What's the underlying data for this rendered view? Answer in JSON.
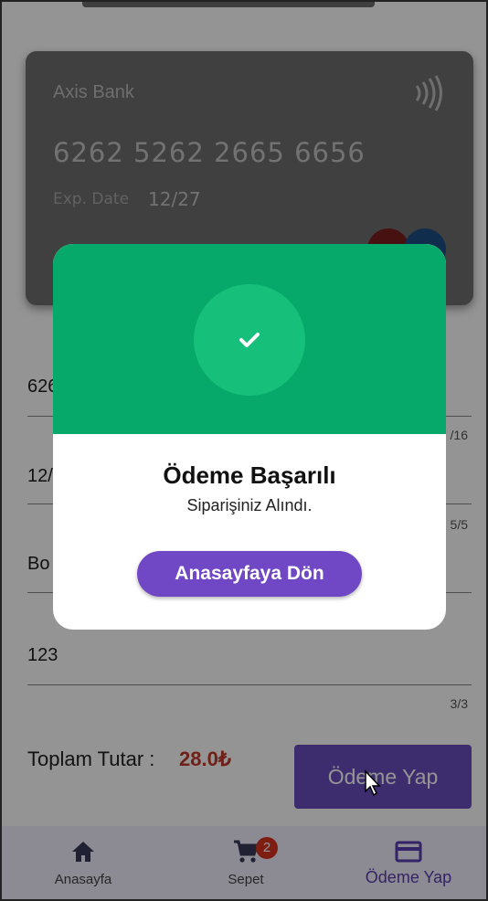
{
  "card": {
    "bank": "Axis Bank",
    "number": "6262 5262 2665 6656",
    "exp_label": "Exp. Date",
    "exp_value": "12/27"
  },
  "form": {
    "fields": [
      {
        "value": "626",
        "counter": "/16"
      },
      {
        "value": "12/",
        "counter": "5/5"
      },
      {
        "value": "Bo",
        "counter": ""
      },
      {
        "value": "123",
        "counter": "3/3"
      }
    ]
  },
  "total": {
    "label": "Toplam Tutar :",
    "amount": "28.0₺"
  },
  "pay_button": "Ödeme Yap",
  "bottom_nav": {
    "items": [
      {
        "label": "Anasayfa",
        "icon": "home-icon"
      },
      {
        "label": "Sepet",
        "icon": "cart-icon",
        "badge": "2"
      },
      {
        "label": "Ödeme Yap",
        "icon": "credit-card-icon"
      }
    ]
  },
  "dialog": {
    "title": "Ödeme Başarılı",
    "message": "Siparişiniz Alındı.",
    "button": "Anasayfaya Dön",
    "icon": "check-icon"
  },
  "colors": {
    "primary": "#6a4fc0",
    "success": "#06a96a",
    "total_amount": "#c0392b",
    "badge": "#d9331e"
  }
}
